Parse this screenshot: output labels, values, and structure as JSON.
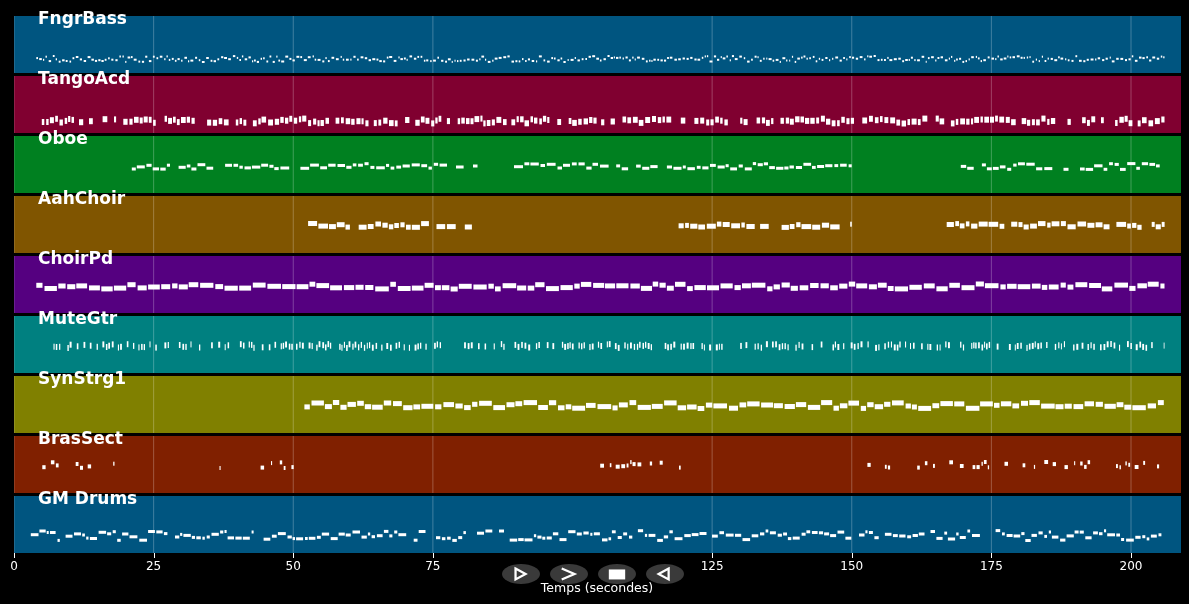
{
  "tracks": [
    {
      "name": "FngrBass",
      "color": "#005580"
    },
    {
      "name": "TangoAcd",
      "color": "#800030"
    },
    {
      "name": "Oboe",
      "color": "#008020"
    },
    {
      "name": "AahChoir",
      "color": "#805500"
    },
    {
      "name": "ChoirPd",
      "color": "#550080"
    },
    {
      "name": "MuteGtr",
      "color": "#008080"
    },
    {
      "name": "SynStrg1",
      "color": "#808000"
    },
    {
      "name": "BrasSect",
      "color": "#802000"
    },
    {
      "name": "GM Drums",
      "color": "#005580"
    }
  ],
  "x_axis": {
    "ticks": [
      "0",
      "25",
      "50",
      "75",
      "125",
      "150",
      "175",
      "200"
    ],
    "label": "Temps (secondes)"
  },
  "transport": [
    {
      "kind": "play"
    },
    {
      "kind": "forward"
    },
    {
      "kind": "stop"
    },
    {
      "kind": "back"
    }
  ]
}
